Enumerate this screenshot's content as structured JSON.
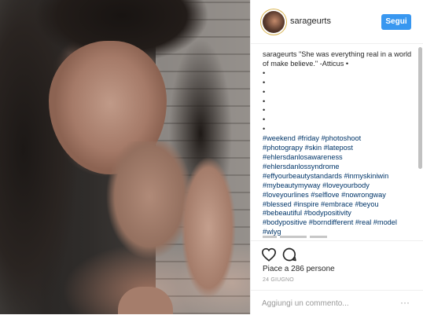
{
  "post": {
    "username": "sarageurts",
    "follow_label": "Segui",
    "caption_quote": "\"She was everything real in a world of make believe.\" -Atticus •",
    "dots": [
      "•",
      "•",
      "•",
      "•",
      "•",
      "•",
      "•"
    ],
    "hashtag_lines": [
      "#weekend #friday #photoshoot",
      "#photograpy #skin #latepost",
      "#ehlersdanlosawareness",
      "#ehlersdanlossyndrome",
      "#effyourbeautystandards #inmyskiniwin",
      "#mybeautymyway #loveyourbody",
      "#loveyourlines #selflove #nowrongway",
      "#blessed #inspire #embrace #beyou",
      "#bebeautiful #bodypositivity",
      "#bodypositive #borndifferent #real #model",
      "#wlyg"
    ],
    "likes_text": "Piace a 286 persone",
    "date_text": "24 GIUGNO",
    "comment_placeholder": "Aggiungi un commento...",
    "more_symbol": "···"
  },
  "icons": {
    "like": "heart-icon",
    "comment": "comment-icon",
    "more": "more-options-icon"
  },
  "colors": {
    "follow_button": "#3897f0",
    "hashtag": "#003569",
    "text": "#262626",
    "muted": "#999999"
  }
}
